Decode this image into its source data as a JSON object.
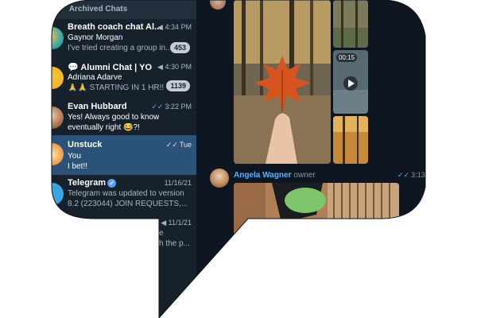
{
  "sidebar": {
    "header": "Archived Chats",
    "chats": [
      {
        "title": "Breath coach chat Al...",
        "time": "4:34 PM",
        "sender": "Gaynor Morgan",
        "preview": "I've tried creating a group in...",
        "badge": "453"
      },
      {
        "title": "💬 Alumni Chat | YO...",
        "time": "4:30 PM",
        "sender": "Adriana Adarve",
        "preview": "🙏🙏 STARTING IN 1 HR!!...",
        "badge": "1139"
      },
      {
        "title": "Evan Hubbard",
        "time": "3:22 PM",
        "preview_line1": "Yes! Always good to know",
        "preview_line2": "eventually right 😂?!"
      },
      {
        "title": "Unstuck",
        "time": "Tue",
        "preview_line1": "You",
        "preview_line2": "I bet!!"
      },
      {
        "title": "Telegram",
        "time": "11/16/21",
        "preview_line1": "Telegram was updated to version",
        "preview_line2": "8.2 (223044)  JOIN REQUESTS,..."
      },
      {
        "time": "11/1/21",
        "preview_line1": "e",
        "preview_line2": "h the p..."
      }
    ]
  },
  "chat": {
    "video_duration": "00:15",
    "sender_name": "Angela Wagner",
    "sender_role": "owner",
    "message_time": "3:13"
  },
  "colors": {
    "sidebar_bg": "#17212b",
    "chat_bg": "#0e1621",
    "selected_row": "#2b5278",
    "accent": "#5ab4ff"
  }
}
